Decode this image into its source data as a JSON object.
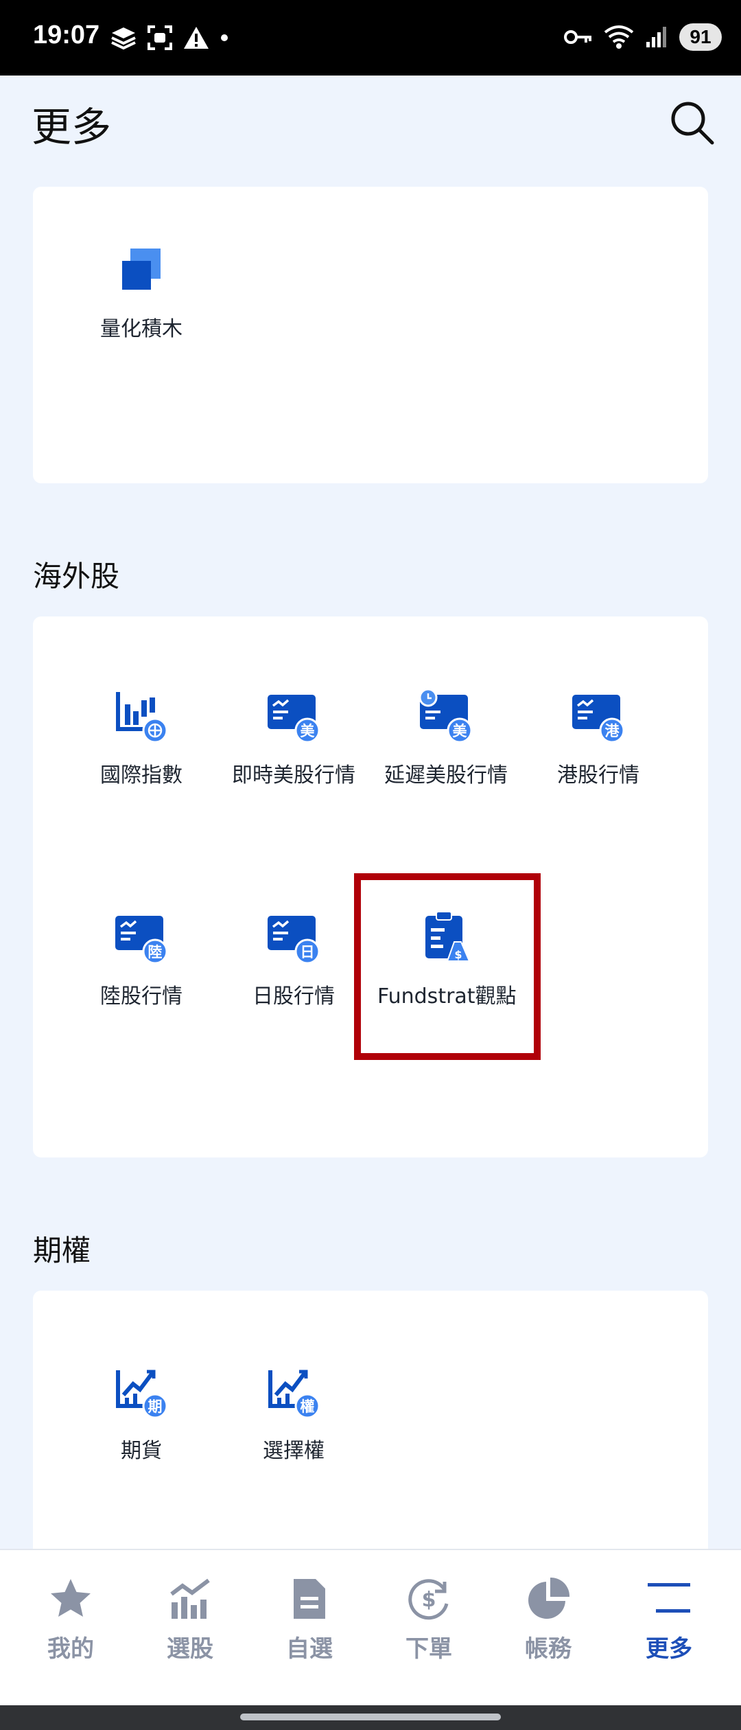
{
  "status": {
    "time": "19:07",
    "battery": "91",
    "signal_sup": "6"
  },
  "header": {
    "title": "更多"
  },
  "sections": {
    "tools": {
      "items": [
        {
          "label": "量化積木",
          "icon": "blocks-icon"
        }
      ]
    },
    "overseas": {
      "title": "海外股",
      "items": [
        {
          "label": "國際指數",
          "icon": "bar-chart-globe-icon"
        },
        {
          "label": "即時美股行情",
          "icon": "quote-card-icon",
          "badge": "美"
        },
        {
          "label": "延遲美股行情",
          "icon": "quote-card-clock-icon",
          "badge": "美"
        },
        {
          "label": "港股行情",
          "icon": "quote-card-icon",
          "badge": "港"
        },
        {
          "label": "陸股行情",
          "icon": "quote-card-icon",
          "badge": "陸"
        },
        {
          "label": "日股行情",
          "icon": "quote-card-icon",
          "badge": "日"
        },
        {
          "label": "Fundstrat觀點",
          "icon": "clipboard-money-icon"
        }
      ]
    },
    "options": {
      "title": "期權",
      "items": [
        {
          "label": "期貨",
          "icon": "trend-chart-icon",
          "badge": "期"
        },
        {
          "label": "選擇權",
          "icon": "trend-chart-icon",
          "badge": "權"
        }
      ]
    }
  },
  "bottom_nav": [
    {
      "label": "我的",
      "icon": "star-icon",
      "active": false
    },
    {
      "label": "選股",
      "icon": "chart-icon",
      "active": false
    },
    {
      "label": "自選",
      "icon": "document-icon",
      "active": false
    },
    {
      "label": "下單",
      "icon": "dollar-cycle-icon",
      "active": false
    },
    {
      "label": "帳務",
      "icon": "pie-chart-icon",
      "active": false
    },
    {
      "label": "更多",
      "icon": "menu-icon",
      "active": true
    }
  ],
  "colors": {
    "brand": "#0b4fc1",
    "light_brand": "#4a8ff0",
    "badge": "#3b82f0",
    "highlight": "#b00008",
    "inactive": "#8b93a5",
    "active": "#1d4fb8"
  }
}
